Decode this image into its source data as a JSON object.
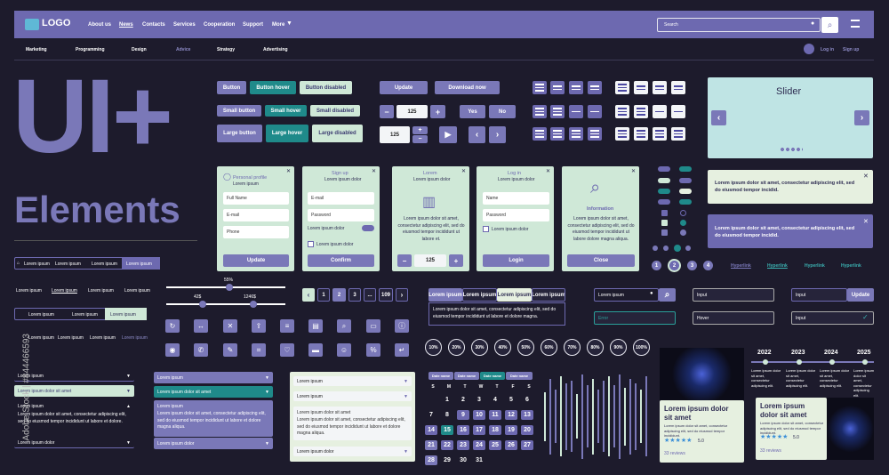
{
  "nav": {
    "logo": "LOGO",
    "links": [
      "About us",
      "News",
      "Contacts",
      "Services",
      "Cooperation",
      "Support",
      "More"
    ],
    "search_placeholder": "Search"
  },
  "subnav": {
    "links": [
      "Marketing",
      "Programming",
      "Design",
      "Advice",
      "Strategy",
      "Advertising"
    ],
    "login": "Log in",
    "signup": "Sign up"
  },
  "hero": {
    "title1": "UI+",
    "title2": "Elements"
  },
  "buttons": {
    "button": "Button",
    "hover": "Button hover",
    "disabled": "Button disabled",
    "small": "Small button",
    "small_hover": "Small hover",
    "small_disabled": "Small disabled",
    "large": "Large button",
    "large_hover": "Large hover",
    "large_disabled": "Large disabled",
    "update": "Update",
    "download": "Download now",
    "yes": "Yes",
    "no": "No",
    "qty1": "125",
    "qty2": "125"
  },
  "slider": {
    "title": "Slider"
  },
  "alerts": {
    "a1": "Lorem ipsum dolor sit amet, consectetur adipiscing elit, sed do eiusmod tempor incidid.",
    "a2": "Lorem ipsum dolor sit amet, consectetur adipiscing elit, sed do eiusmod tempor incidid."
  },
  "forms": {
    "profile": {
      "title": "Personal profile",
      "sub": "Lorem ipsum",
      "f1": "Full Name",
      "f2": "E-mail",
      "f3": "Phone",
      "btn": "Update"
    },
    "signup": {
      "title": "Sign up",
      "sub": "Lorem ipsum dolor",
      "f1": "E-mail",
      "f2": "Password",
      "toggle": "Lorem ipsum dolor",
      "check": "Lorem ipsum dolor",
      "btn": "Confirm"
    },
    "lorem": {
      "title": "Lorem",
      "sub": "Lorem ipsum dolor",
      "text": "Lorem ipsum dolor sit amet, consectetur adipiscing elit, sed do eiusmod tempor incididunt ut labore et.",
      "qty": "125"
    },
    "login": {
      "title": "Log in",
      "sub": "Lorem ipsum dolor",
      "f1": "Name",
      "f2": "Password",
      "check": "Lorem ipsum dolor",
      "btn": "Login"
    },
    "info": {
      "title": "Information",
      "text": "Lorem ipsum dolor sit amet, consectetur adipiscing elit, sed do eiusmod tempor incididunt ut labore dolore magna aliqua.",
      "btn": "Close"
    }
  },
  "pager": {
    "dots": [
      "1",
      "2",
      "3",
      "4"
    ],
    "hyperlinks": [
      "Hyperlink",
      "Hyperlink",
      "Hyperlink",
      "Hyperlink"
    ],
    "pages": [
      "1",
      "2",
      "3",
      "...",
      "109"
    ]
  },
  "breadcrumbs": {
    "item": "Lorem ipsum",
    "item_short": "Lorem ipsum"
  },
  "range": {
    "pct": "55%",
    "min": "42$",
    "max": "1246$"
  },
  "tabs": {
    "labels": [
      "Lorem ipsum",
      "Lorem ipsum",
      "Lorem ipsum",
      "Lorem ipsum"
    ],
    "text": "Lorem ipsum dolor sit amet, consectetur adipiscing elit, sed do eiusmod tempor incididunt ut labore et dolore magna."
  },
  "search2": {
    "ph": "Lorem ipsum"
  },
  "inputs": {
    "input": "Input",
    "update": "Update",
    "error": "Error",
    "hover": "Hover",
    "input2": "Input"
  },
  "percents": [
    "10%",
    "20%",
    "30%",
    "40%",
    "50%",
    "60%",
    "70%",
    "80%",
    "90%",
    "100%"
  ],
  "accordion1": {
    "items": [
      "Lorem ipsum",
      "Lorem ipsum dolor sit amet",
      "Lorem ipsum",
      "Lorem ipsum dolor"
    ],
    "text": "Lorem ipsum dolor sit amet, consectetur adipiscing elit, sed do eiusmod tempor incididunt ut labore et dolore."
  },
  "accordion2": {
    "items": [
      "Lorem ipsum",
      "Lorem ipsum dolor sit amet",
      "Lorem ipsum",
      "Lorem ipsum dolor"
    ],
    "text": "Lorem ipsum dolor sit amet, consectetur adipiscing elit, sed do eiusmod tempor incididunt ut labore et dolore magna aliqua."
  },
  "accordion3": {
    "items": [
      "Lorem ipsum",
      "Lorem ipsum",
      "Lorem ipsum dolor sit amet",
      "Lorem ipsum dolor"
    ],
    "text": "Lorem ipsum dolor sit amet, consectetur adipiscing elit, sed do eiusmod tempor incididunt ut labore et dolore magna aliqua."
  },
  "calendar": {
    "tabs": [
      "Date name",
      "Date name",
      "Date name",
      "Date name"
    ],
    "days": [
      "S",
      "M",
      "T",
      "W",
      "T",
      "F",
      "S"
    ],
    "dates": [
      "",
      "1",
      "2",
      "3",
      "4",
      "5",
      "6",
      "7",
      "8",
      "9",
      "10",
      "11",
      "12",
      "13",
      "14",
      "15",
      "16",
      "17",
      "18",
      "19",
      "20",
      "21",
      "22",
      "23",
      "24",
      "25",
      "26",
      "27",
      "28",
      "29",
      "30",
      "31"
    ]
  },
  "timeline": {
    "years": [
      "2022",
      "2023",
      "2024",
      "2025"
    ],
    "text": "Lorem ipsum dolor sit amet, consectetur adipiscing elit."
  },
  "product": {
    "title": "Lorem ipsum dolor sit amet",
    "text": "Lorem ipsum dolor sit amet, consectetur adipiscing elit, sed do eiusmod tempor incididunt.",
    "rating": "5.0",
    "reviews": "33 reviews"
  },
  "watermark": {
    "side": "Adobe Stock | #844466593"
  }
}
